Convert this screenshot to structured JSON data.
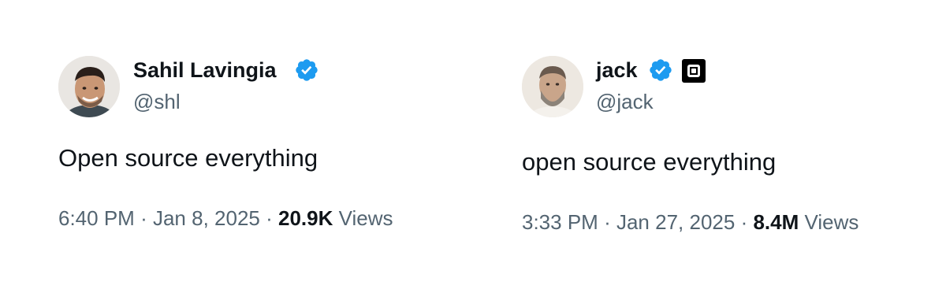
{
  "tweets": [
    {
      "display_name": "Sahil Lavingia",
      "handle": "@shl",
      "verified": true,
      "text": "Open source everything",
      "time": "6:40 PM",
      "date": "Jan 8, 2025",
      "view_count": "20.9K",
      "views_label": "Views",
      "separator": "·"
    },
    {
      "display_name": "jack",
      "handle": "@jack",
      "verified": true,
      "affiliation_badge": "square-logo-icon",
      "text": "open source everything",
      "time": "3:33 PM",
      "date": "Jan 27, 2025",
      "view_count": "8.4M",
      "views_label": "Views",
      "separator": "·"
    }
  ],
  "colors": {
    "verified_blue": "#1d9bf0",
    "text_primary": "#0f1419",
    "text_secondary": "#536471"
  }
}
